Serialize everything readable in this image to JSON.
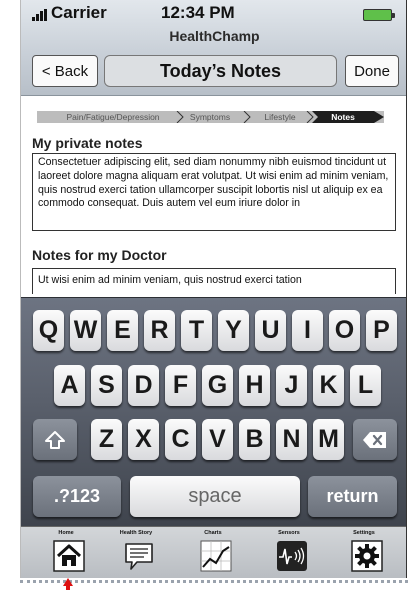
{
  "status": {
    "carrier": "Carrier",
    "time": "12:34 PM"
  },
  "app": {
    "name": "HealthChamp"
  },
  "navbar": {
    "back_label": "< Back",
    "title": "Today’s Notes",
    "done_label": "Done"
  },
  "breadcrumb": {
    "steps": [
      "Pain/Fatigue/Depression",
      "Symptoms",
      "Lifestyle",
      "Notes"
    ],
    "active": "Notes"
  },
  "private_notes": {
    "title": "My private notes",
    "text": "Consectetuer adipiscing elit, sed diam nonummy nibh euismod tincidunt ut laoreet dolore magna aliquam erat volutpat. Ut wisi enim ad minim veniam, quis nostrud exerci tation ullamcorper suscipit lobortis nisl ut aliquip ex ea commodo consequat. Duis autem vel eum iriure dolor in"
  },
  "doctor_notes": {
    "title": "Notes for my Doctor",
    "text": "Ut wisi enim ad minim veniam, quis nostrud exerci tation"
  },
  "keyboard": {
    "row1": [
      "Q",
      "W",
      "E",
      "R",
      "T",
      "Y",
      "U",
      "I",
      "O",
      "P"
    ],
    "row2": [
      "A",
      "S",
      "D",
      "F",
      "G",
      "H",
      "J",
      "K",
      "L"
    ],
    "row3": [
      "Z",
      "X",
      "C",
      "V",
      "B",
      "N",
      "M"
    ],
    "numbers_label": ".?123",
    "space_label": "space",
    "return_label": "return",
    "shift_icon": "shift-arrow-icon",
    "delete_icon": "backspace-icon"
  },
  "tabbar": {
    "tabs": [
      {
        "label": "Home",
        "icon": "home-icon"
      },
      {
        "label": "Health Story",
        "icon": "speech-bubble-icon"
      },
      {
        "label": "Charts",
        "icon": "line-chart-icon"
      },
      {
        "label": "Sensors",
        "icon": "waveform-icon"
      },
      {
        "label": "Settings",
        "icon": "gear-icon"
      }
    ]
  },
  "colors": {
    "battery": "#5fc04a",
    "pointer": "#dd1111",
    "keyboard_bg": "#5a606c"
  }
}
